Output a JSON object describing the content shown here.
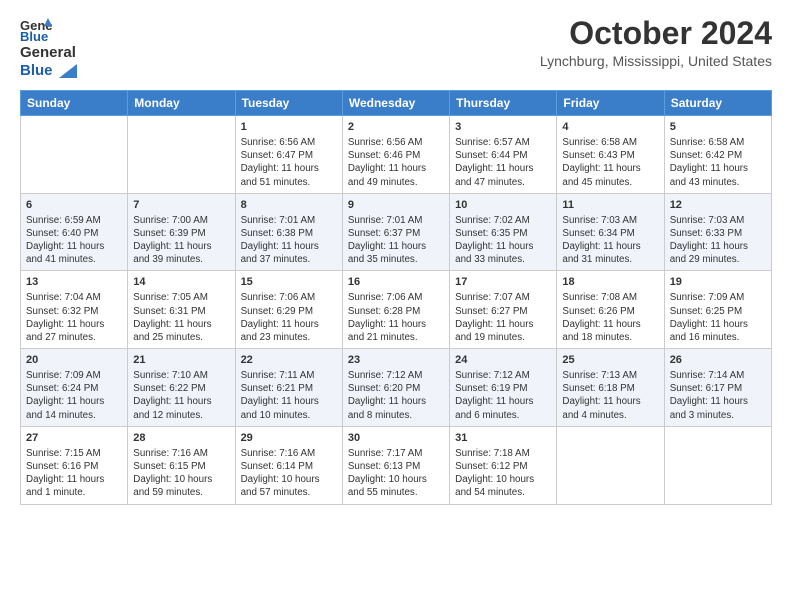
{
  "header": {
    "logo_line1": "General",
    "logo_line2": "Blue",
    "month": "October 2024",
    "location": "Lynchburg, Mississippi, United States"
  },
  "days_of_week": [
    "Sunday",
    "Monday",
    "Tuesday",
    "Wednesday",
    "Thursday",
    "Friday",
    "Saturday"
  ],
  "weeks": [
    [
      {
        "day": "",
        "detail": ""
      },
      {
        "day": "",
        "detail": ""
      },
      {
        "day": "1",
        "detail": "Sunrise: 6:56 AM\nSunset: 6:47 PM\nDaylight: 11 hours and 51 minutes."
      },
      {
        "day": "2",
        "detail": "Sunrise: 6:56 AM\nSunset: 6:46 PM\nDaylight: 11 hours and 49 minutes."
      },
      {
        "day": "3",
        "detail": "Sunrise: 6:57 AM\nSunset: 6:44 PM\nDaylight: 11 hours and 47 minutes."
      },
      {
        "day": "4",
        "detail": "Sunrise: 6:58 AM\nSunset: 6:43 PM\nDaylight: 11 hours and 45 minutes."
      },
      {
        "day": "5",
        "detail": "Sunrise: 6:58 AM\nSunset: 6:42 PM\nDaylight: 11 hours and 43 minutes."
      }
    ],
    [
      {
        "day": "6",
        "detail": "Sunrise: 6:59 AM\nSunset: 6:40 PM\nDaylight: 11 hours and 41 minutes."
      },
      {
        "day": "7",
        "detail": "Sunrise: 7:00 AM\nSunset: 6:39 PM\nDaylight: 11 hours and 39 minutes."
      },
      {
        "day": "8",
        "detail": "Sunrise: 7:01 AM\nSunset: 6:38 PM\nDaylight: 11 hours and 37 minutes."
      },
      {
        "day": "9",
        "detail": "Sunrise: 7:01 AM\nSunset: 6:37 PM\nDaylight: 11 hours and 35 minutes."
      },
      {
        "day": "10",
        "detail": "Sunrise: 7:02 AM\nSunset: 6:35 PM\nDaylight: 11 hours and 33 minutes."
      },
      {
        "day": "11",
        "detail": "Sunrise: 7:03 AM\nSunset: 6:34 PM\nDaylight: 11 hours and 31 minutes."
      },
      {
        "day": "12",
        "detail": "Sunrise: 7:03 AM\nSunset: 6:33 PM\nDaylight: 11 hours and 29 minutes."
      }
    ],
    [
      {
        "day": "13",
        "detail": "Sunrise: 7:04 AM\nSunset: 6:32 PM\nDaylight: 11 hours and 27 minutes."
      },
      {
        "day": "14",
        "detail": "Sunrise: 7:05 AM\nSunset: 6:31 PM\nDaylight: 11 hours and 25 minutes."
      },
      {
        "day": "15",
        "detail": "Sunrise: 7:06 AM\nSunset: 6:29 PM\nDaylight: 11 hours and 23 minutes."
      },
      {
        "day": "16",
        "detail": "Sunrise: 7:06 AM\nSunset: 6:28 PM\nDaylight: 11 hours and 21 minutes."
      },
      {
        "day": "17",
        "detail": "Sunrise: 7:07 AM\nSunset: 6:27 PM\nDaylight: 11 hours and 19 minutes."
      },
      {
        "day": "18",
        "detail": "Sunrise: 7:08 AM\nSunset: 6:26 PM\nDaylight: 11 hours and 18 minutes."
      },
      {
        "day": "19",
        "detail": "Sunrise: 7:09 AM\nSunset: 6:25 PM\nDaylight: 11 hours and 16 minutes."
      }
    ],
    [
      {
        "day": "20",
        "detail": "Sunrise: 7:09 AM\nSunset: 6:24 PM\nDaylight: 11 hours and 14 minutes."
      },
      {
        "day": "21",
        "detail": "Sunrise: 7:10 AM\nSunset: 6:22 PM\nDaylight: 11 hours and 12 minutes."
      },
      {
        "day": "22",
        "detail": "Sunrise: 7:11 AM\nSunset: 6:21 PM\nDaylight: 11 hours and 10 minutes."
      },
      {
        "day": "23",
        "detail": "Sunrise: 7:12 AM\nSunset: 6:20 PM\nDaylight: 11 hours and 8 minutes."
      },
      {
        "day": "24",
        "detail": "Sunrise: 7:12 AM\nSunset: 6:19 PM\nDaylight: 11 hours and 6 minutes."
      },
      {
        "day": "25",
        "detail": "Sunrise: 7:13 AM\nSunset: 6:18 PM\nDaylight: 11 hours and 4 minutes."
      },
      {
        "day": "26",
        "detail": "Sunrise: 7:14 AM\nSunset: 6:17 PM\nDaylight: 11 hours and 3 minutes."
      }
    ],
    [
      {
        "day": "27",
        "detail": "Sunrise: 7:15 AM\nSunset: 6:16 PM\nDaylight: 11 hours and 1 minute."
      },
      {
        "day": "28",
        "detail": "Sunrise: 7:16 AM\nSunset: 6:15 PM\nDaylight: 10 hours and 59 minutes."
      },
      {
        "day": "29",
        "detail": "Sunrise: 7:16 AM\nSunset: 6:14 PM\nDaylight: 10 hours and 57 minutes."
      },
      {
        "day": "30",
        "detail": "Sunrise: 7:17 AM\nSunset: 6:13 PM\nDaylight: 10 hours and 55 minutes."
      },
      {
        "day": "31",
        "detail": "Sunrise: 7:18 AM\nSunset: 6:12 PM\nDaylight: 10 hours and 54 minutes."
      },
      {
        "day": "",
        "detail": ""
      },
      {
        "day": "",
        "detail": ""
      }
    ]
  ]
}
